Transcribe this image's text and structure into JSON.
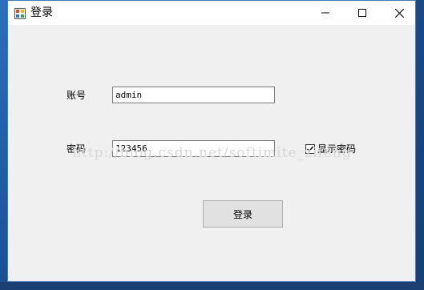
{
  "window": {
    "title": "登录",
    "controls": {
      "minimize": "minimize-icon",
      "maximize": "maximize-icon",
      "close": "close-icon"
    }
  },
  "form": {
    "account_label": "账号",
    "account_value": "admin",
    "password_label": "密码",
    "password_value": "123456",
    "show_password_label": "显示密码",
    "show_password_checked": true,
    "login_button": "登录"
  },
  "watermark": "http://blog.csdn.net/softimite_zifeng",
  "colors": {
    "window_bg": "#f0f0f0",
    "titlebar_bg": "#ffffff",
    "button_bg": "#e1e1e1",
    "desktop_accent": "#1f5fa6"
  }
}
